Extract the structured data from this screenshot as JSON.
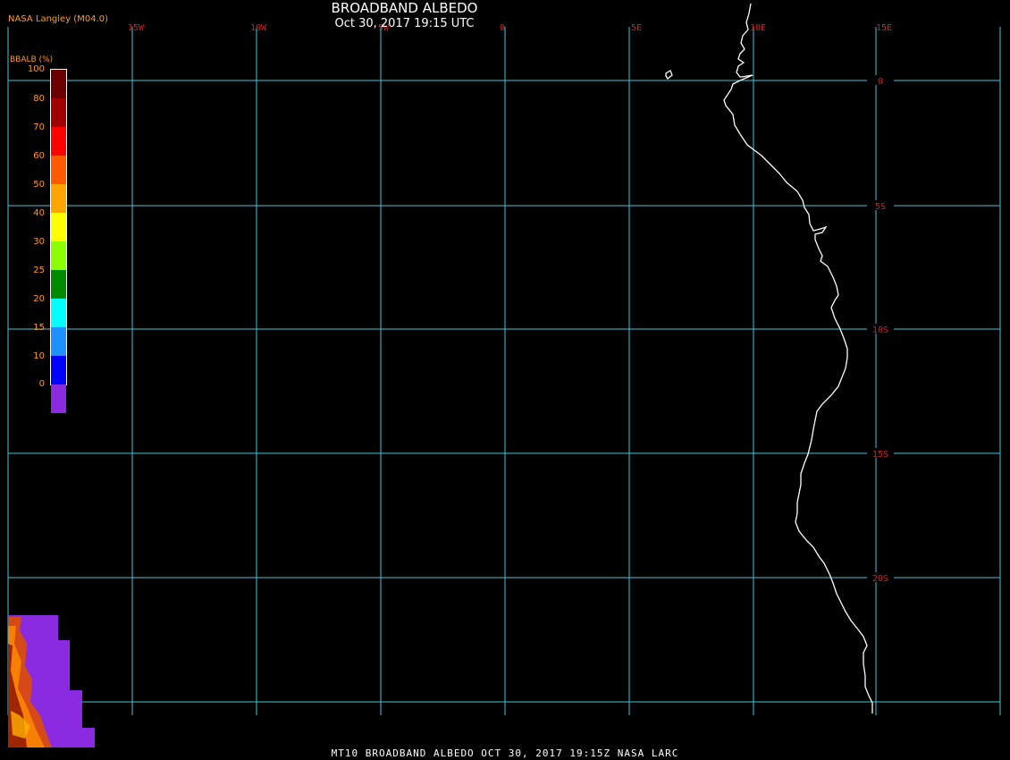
{
  "header": {
    "title": "BROADBAND ALBEDO",
    "timestamp": "Oct 30, 2017 19:15 UTC",
    "credit": "NASA Langley (M04.0)"
  },
  "colorbar": {
    "label": "BBALB (%)",
    "ticks": [
      "100",
      "80",
      "70",
      "60",
      "50",
      "40",
      "30",
      "25",
      "20",
      "15",
      "10",
      "0"
    ],
    "colors": [
      "#6b0000",
      "#a00000",
      "#ff0000",
      "#ff5a00",
      "#ffa500",
      "#ffff00",
      "#8cff00",
      "#008a00",
      "#00ffff",
      "#1e90ff",
      "#0000ff",
      "#8a2be2"
    ]
  },
  "grid": {
    "lon_labels": [
      "15W",
      "10W",
      "5W",
      "0",
      "5E",
      "10E",
      "15E"
    ],
    "lat_labels": [
      "0",
      "5S",
      "10S",
      "15S",
      "20S"
    ],
    "line_color": "#3fc6d8",
    "label_color": "#d42020"
  },
  "coastline_color": "#ffffff",
  "footer": "MT10  BROADBAND ALBEDO   OCT 30, 2017 19:15Z   NASA LARC"
}
